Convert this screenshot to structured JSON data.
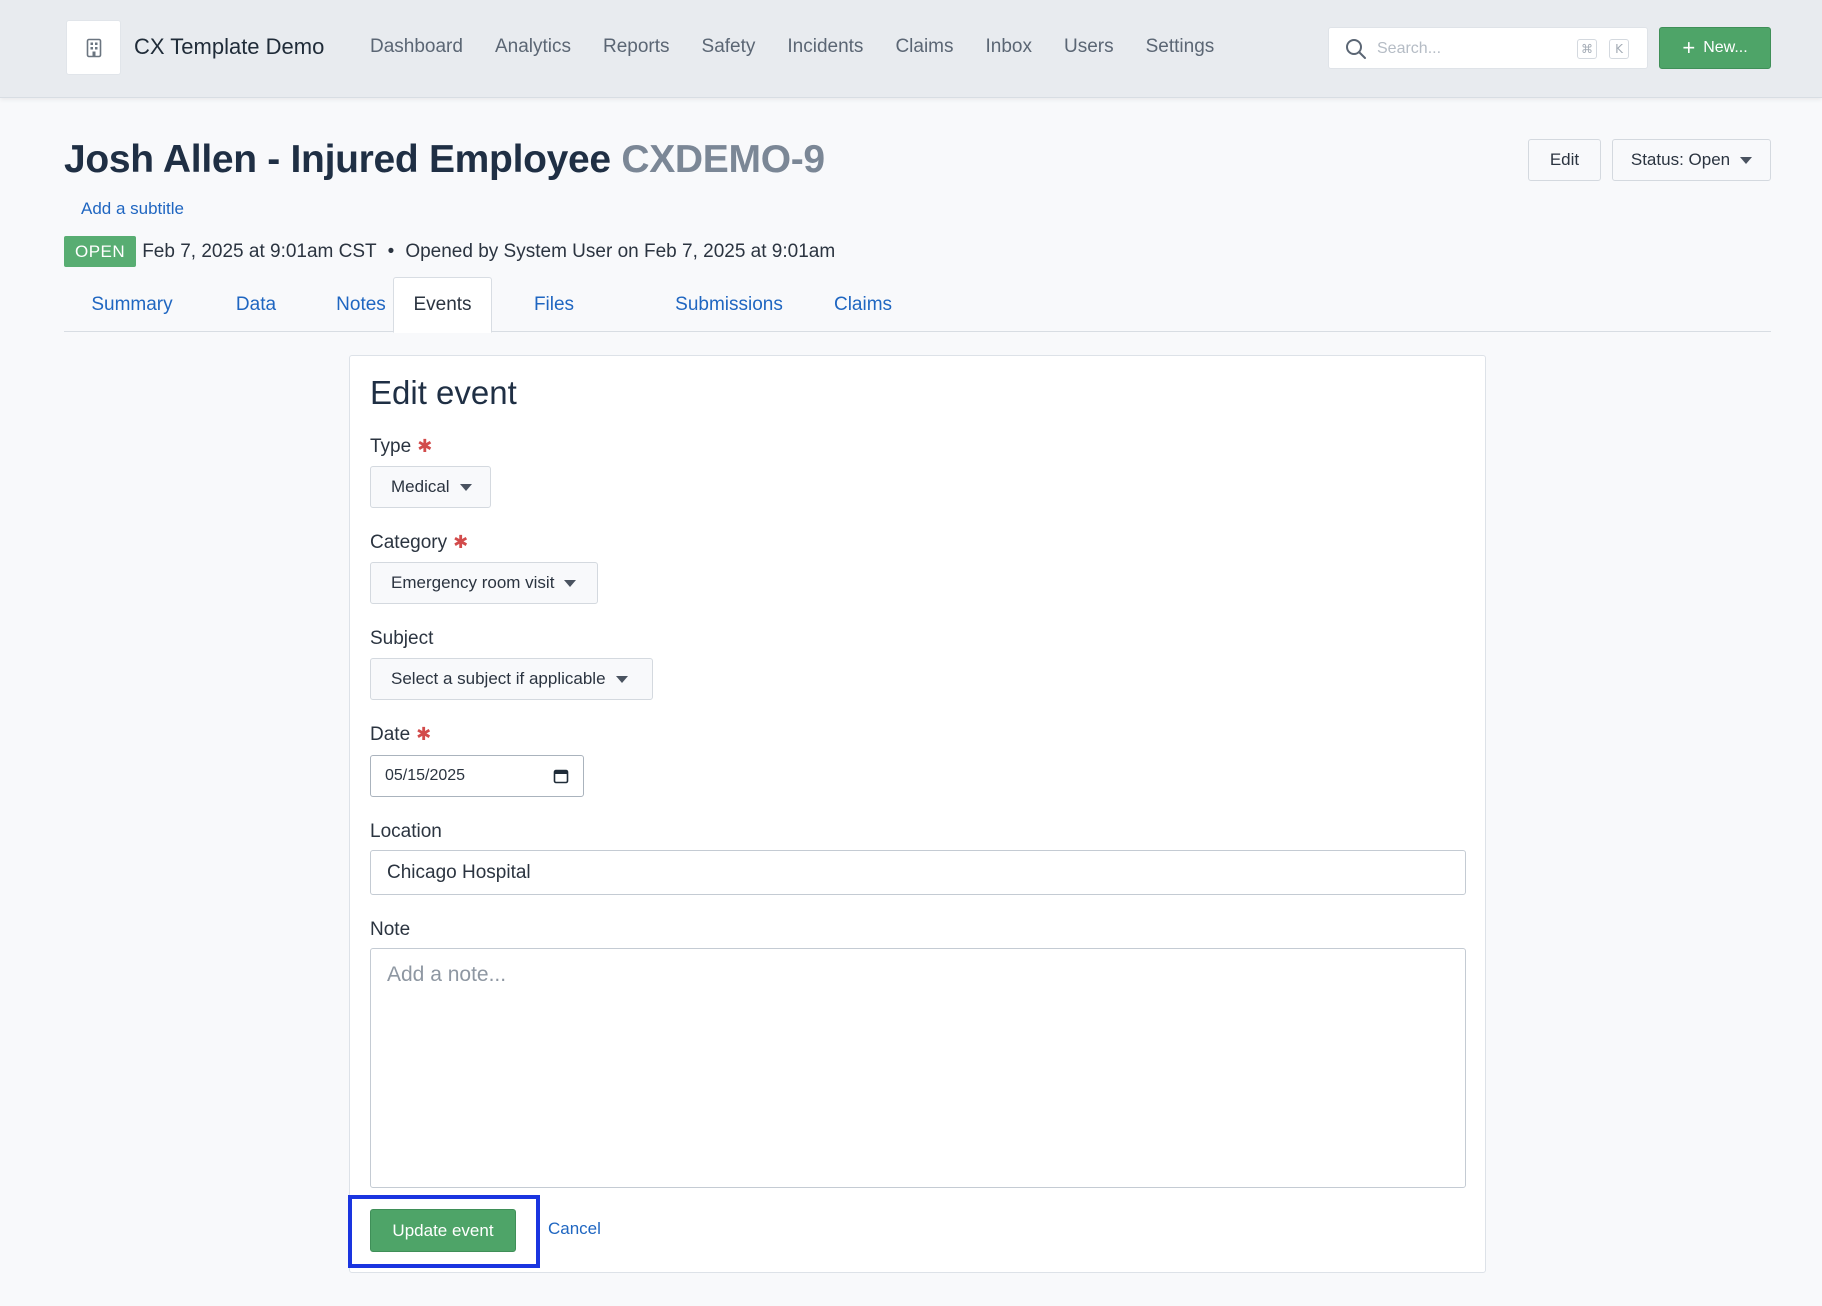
{
  "app": {
    "title": "CX Template Demo",
    "logo_icon": "building-icon"
  },
  "nav": {
    "items": [
      "Dashboard",
      "Analytics",
      "Reports",
      "Safety",
      "Incidents",
      "Claims",
      "Inbox",
      "Users",
      "Settings"
    ]
  },
  "search": {
    "placeholder": "Search...",
    "shortcut_keys": [
      "⌘",
      "K"
    ]
  },
  "new_button": {
    "label": "New...",
    "icon": "plus-icon"
  },
  "header": {
    "title": "Josh Allen - Injured Employee",
    "case_id": "CXDEMO-9",
    "subtitle_link": "Add a subtitle",
    "edit_label": "Edit",
    "status_label": "Status: Open",
    "badge": "OPEN",
    "opened_date": "Feb 7, 2025 at 9:01am CST",
    "separator": "•",
    "opened_by": "Opened by System User on Feb 7, 2025 at 9:01am"
  },
  "tabs": [
    {
      "label": "Summary",
      "active": false
    },
    {
      "label": "Data",
      "active": false
    },
    {
      "label": "Notes",
      "active": false
    },
    {
      "label": "Events",
      "active": true
    },
    {
      "label": "Files",
      "active": false
    },
    {
      "label": "Submissions",
      "active": false
    },
    {
      "label": "Claims",
      "active": false
    }
  ],
  "form": {
    "title": "Edit event",
    "required_marker": "✱",
    "type": {
      "label": "Type",
      "value": "Medical",
      "required": true
    },
    "category": {
      "label": "Category",
      "value": "Emergency room visit",
      "required": true
    },
    "subject": {
      "label": "Subject",
      "value": "Select a subject if applicable",
      "required": false
    },
    "date": {
      "label": "Date",
      "value": "05/15/2025",
      "required": true
    },
    "location": {
      "label": "Location",
      "value": "Chicago Hospital"
    },
    "note": {
      "label": "Note",
      "placeholder": "Add a note...",
      "value": ""
    },
    "submit_label": "Update event",
    "cancel_label": "Cancel"
  },
  "colors": {
    "accent_green": "#4ea468",
    "link_blue": "#1f66c1",
    "required_red": "#d24b4b",
    "highlight_blue": "#1a35e0",
    "badge_green": "#58ad72"
  }
}
